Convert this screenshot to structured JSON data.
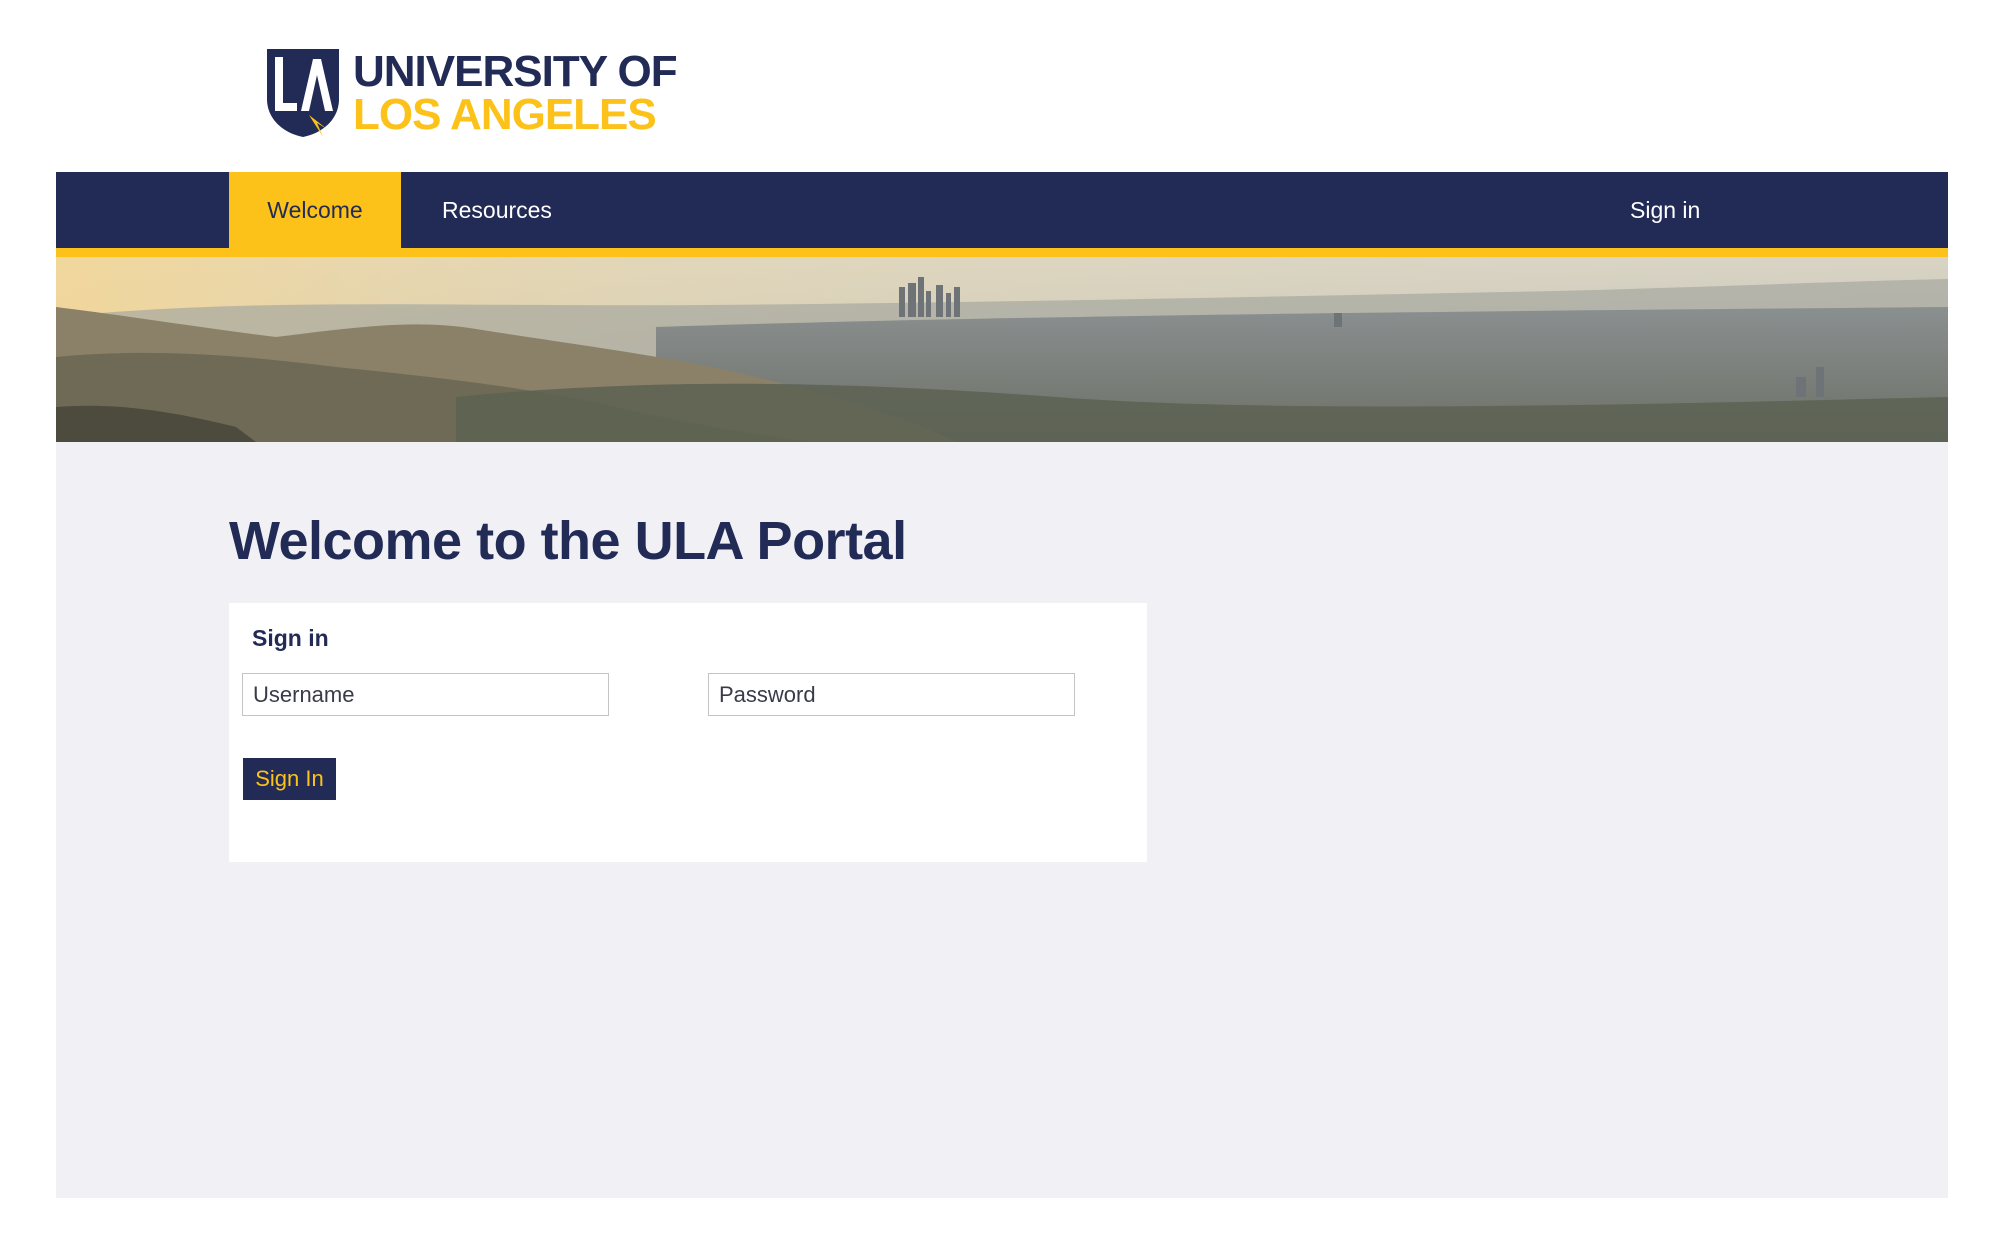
{
  "logo": {
    "monogram": "LA",
    "line1": "UNIVERSITY OF",
    "line2": "LOS ANGELES"
  },
  "nav": {
    "items": [
      {
        "label": "Welcome",
        "active": true
      },
      {
        "label": "Resources",
        "active": false
      }
    ],
    "signin_label": "Sign in"
  },
  "main": {
    "title": "Welcome to the ULA Portal",
    "signin_card": {
      "heading": "Sign in",
      "username_placeholder": "Username",
      "password_placeholder": "Password",
      "button_label": "Sign In"
    }
  },
  "colors": {
    "navy": "#222b56",
    "gold": "#fcc21a",
    "background": "#f1f1f5"
  }
}
